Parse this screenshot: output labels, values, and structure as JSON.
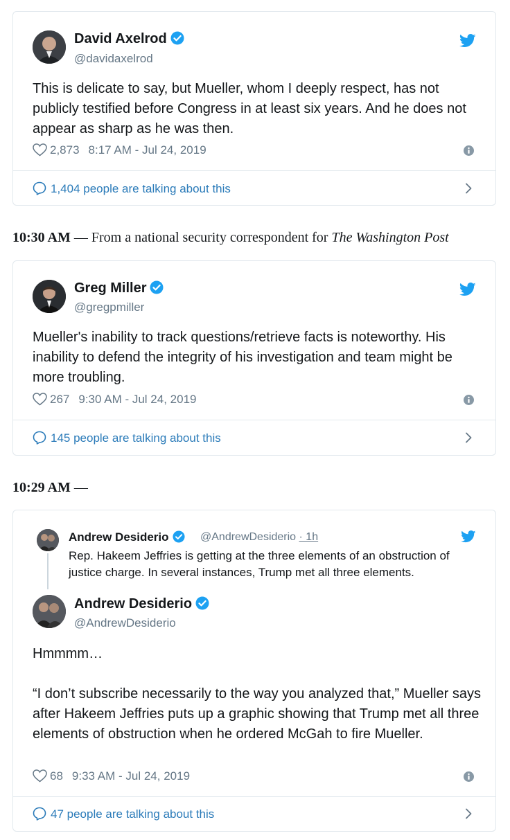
{
  "tweet1": {
    "name": "David Axelrod",
    "handle": "@davidaxelrod",
    "text": "This is delicate to say, but Mueller, whom I deeply respect, has not publicly testified before Congress in at least six years.  And he does not appear as sharp as he was then.",
    "likes": "2,873",
    "time": "8:17 AM - Jul 24, 2019",
    "talking": "1,404 people are talking about this"
  },
  "heading1": {
    "time": "10:30 AM",
    "dash": " — ",
    "text": "From a national security correspondent for ",
    "publication": "The Washington Post"
  },
  "tweet2": {
    "name": "Greg Miller",
    "handle": "@gregpmiller",
    "text": "Mueller's inability to track questions/retrieve facts is noteworthy. His inability to defend the integrity of his investigation and team might be more troubling.",
    "likes": "267",
    "time": "9:30 AM - Jul 24, 2019",
    "talking": "145 people are talking about this"
  },
  "heading2": {
    "time": "10:29 AM",
    "dash": " —"
  },
  "tweet3": {
    "quoted": {
      "name": "Andrew Desiderio",
      "handle": "@AndrewDesiderio",
      "age": "· 1h",
      "text": "Rep. Hakeem Jeffries is getting at the three elements of an obstruction of justice charge. In several instances, Trump met all three elements."
    },
    "name": "Andrew Desiderio",
    "handle": "@AndrewDesiderio",
    "text": "Hmmmm…\n\n“I don’t subscribe necessarily to the way you analyzed that,” Mueller says after Hakeem Jeffries puts up a graphic showing that Trump met all three elements of obstruction when he ordered McGah to fire Mueller.",
    "likes": "68",
    "time": "9:33 AM - Jul 24, 2019",
    "talking": "47 people are talking about this"
  },
  "colors": {
    "link": "#2b7bb9",
    "twitter_blue": "#1da1f2",
    "muted": "#657786",
    "border": "#e1e8ed"
  },
  "icons": [
    "verified-badge-icon",
    "twitter-bird-icon",
    "heart-icon",
    "info-icon",
    "speech-bubble-icon",
    "chevron-right-icon"
  ]
}
